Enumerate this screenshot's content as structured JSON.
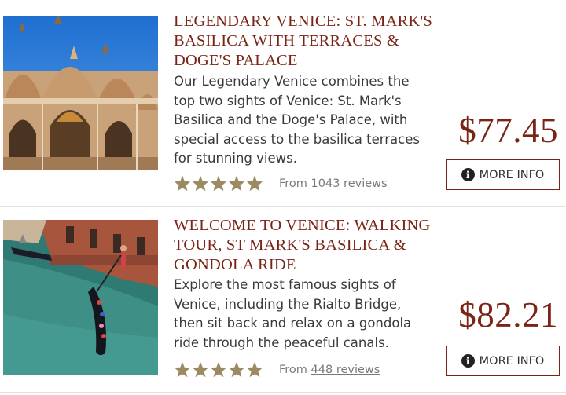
{
  "listings": [
    {
      "title": "LEGENDARY VENICE: ST. MARK'S BASILICA WITH TERRACES & DOGE'S PALACE",
      "description": "Our Legendary Venice combines the top two sights of Venice: St. Mark's Basilica and the Doge's Palace, with special access to the basilica terraces for stunning views.",
      "rating_stars": 5,
      "reviews_prefix": "From",
      "reviews_link": "1043 reviews",
      "price": "$77.45",
      "button_icon": "i",
      "button_label": "MORE INFO",
      "image_icon": "basilica-photo"
    },
    {
      "title": "WELCOME TO VENICE: WALKING TOUR, ST MARK'S BASILICA & GONDOLA RIDE",
      "description": "Explore the most famous sights of Venice, including the Rialto Bridge, then sit back and relax on a gondola ride through the peaceful canals.",
      "rating_stars": 5,
      "reviews_prefix": "From",
      "reviews_link": "448 reviews",
      "price": "$82.21",
      "button_icon": "i",
      "button_label": "MORE INFO",
      "image_icon": "gondola-photo"
    }
  ],
  "colors": {
    "accent": "#7a2416",
    "star": "#9c8a62",
    "rule": "#e6e2dc"
  }
}
